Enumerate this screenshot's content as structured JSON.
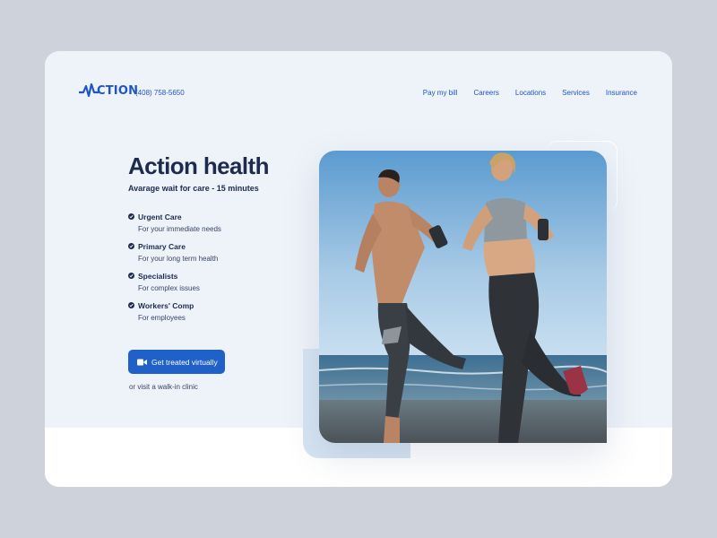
{
  "header": {
    "logo_text": "CTION",
    "phone": "(408) 758-5650",
    "nav": [
      "Pay my bill",
      "Careers",
      "Locations",
      "Services",
      "Insurance"
    ]
  },
  "hero": {
    "title": "Action health",
    "subtitle": "Avarage wait for care - 15 minutes",
    "services": [
      {
        "title": "Urgent Care",
        "desc": "For your immediate needs"
      },
      {
        "title": "Primary Care",
        "desc": "For your long term health"
      },
      {
        "title": "Specialists",
        "desc": "For complex issues"
      },
      {
        "title": "Workers' Comp",
        "desc": "For employees"
      }
    ],
    "cta_label": "Get treated virtually",
    "cta_icon": "video-camera-icon",
    "walkin_link": "or visit a walk-in clinic"
  },
  "colors": {
    "accent": "#2060c9",
    "brand": "#1f55c4",
    "heading": "#1e2b4f",
    "card_bg": "#eef3f9",
    "page_bg": "#cdd2db"
  }
}
